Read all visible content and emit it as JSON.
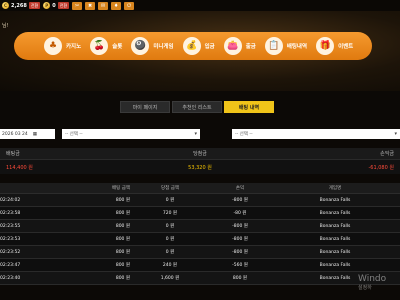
{
  "topbar": {
    "coin_symbol": "C",
    "money": "2,268",
    "money_btn": "전환",
    "point_symbol": "P",
    "point": "0",
    "point_btn": "전환",
    "icons": [
      "scissors-icon",
      "utensils-icon",
      "mail-icon",
      "bell-icon",
      "logout-icon"
    ]
  },
  "greeting": "님!",
  "nav": {
    "items": [
      {
        "label": "카지노",
        "icon": "♣"
      },
      {
        "label": "슬롯",
        "icon": "🍒"
      },
      {
        "label": "미니게임",
        "icon": "🎱"
      },
      {
        "label": "입금",
        "icon": "💰"
      },
      {
        "label": "출금",
        "icon": "👛"
      },
      {
        "label": "배팅내역",
        "icon": "📋"
      },
      {
        "label": "이벤트",
        "icon": "🎁"
      }
    ]
  },
  "tabs": [
    "마이 페이지",
    "추천인 리스트",
    "배팅 내역"
  ],
  "filters": {
    "date": "2026 03 24",
    "select1": "-- 선택 --",
    "select2": "-- 선택 --"
  },
  "summary": {
    "headers": [
      "배팅금",
      "당첨금",
      "손익금"
    ],
    "values": [
      "114,400 원",
      "53,320 원",
      "-61,080 원"
    ]
  },
  "table": {
    "headers": [
      "",
      "배팅 금액",
      "당첨 금액",
      "손익",
      "게임명"
    ],
    "rows": [
      [
        "02:24:02",
        "800 원",
        "0 원",
        "-800 원",
        "Bonanza Falls"
      ],
      [
        "02:23:58",
        "800 원",
        "720 원",
        "-80 원",
        "Bonanza Falls"
      ],
      [
        "02:23:55",
        "800 원",
        "0 원",
        "-800 원",
        "Bonanza Falls"
      ],
      [
        "02:23:53",
        "800 원",
        "0 원",
        "-800 원",
        "Bonanza Falls"
      ],
      [
        "02:23:52",
        "800 원",
        "0 원",
        "-800 원",
        "Bonanza Falls"
      ],
      [
        "02:23:47",
        "800 원",
        "240 원",
        "-560 원",
        "Bonanza Falls"
      ],
      [
        "02:23:40",
        "800 원",
        "1,600 원",
        "800 원",
        "Bonanza Falls"
      ]
    ]
  },
  "watermark": {
    "line1": "Windo",
    "line2": "설정하"
  }
}
